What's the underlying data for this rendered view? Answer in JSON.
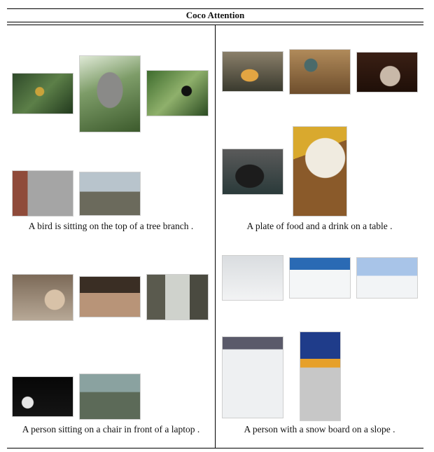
{
  "title": "Coco Attention",
  "captions": {
    "bird": "A bird is sitting on the top of a tree branch .",
    "food": "A plate of food and a drink on a table .",
    "laptop": "A person sitting on a chair in front of a laptop .",
    "snow": "A person with a snow board on a slope ."
  }
}
